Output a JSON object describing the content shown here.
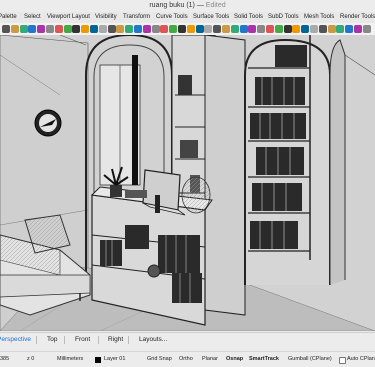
{
  "window": {
    "title": "ruang buku (1)",
    "separator": "—",
    "status": "Edited"
  },
  "menu_tabs": [
    "Palette",
    "Select",
    "Viewport Layout",
    "Visibility",
    "Transform",
    "Curve Tools",
    "Surface Tools",
    "Solid Tools",
    "SubD Tools",
    "Mesh Tools",
    "Render Tools"
  ],
  "toolbar_icons": [
    "pointer-icon",
    "undo-icon",
    "redo-icon",
    "copy-icon",
    "paste-icon",
    "pan-icon",
    "rotate-icon",
    "zoom-icon",
    "zoom-window-icon",
    "zoom-extents-icon",
    "perspective-icon",
    "top-view-icon",
    "front-view-icon",
    "right-view-icon",
    "layout-icon",
    "grid-icon",
    "ortho-icon",
    "planar-icon",
    "osnap-icon",
    "layer-icon",
    "properties-icon",
    "line-icon",
    "polyline-icon",
    "curve-icon",
    "circle-icon",
    "arc-icon",
    "rectangle-icon",
    "polygon-icon",
    "box-icon",
    "sphere-icon",
    "cylinder-icon",
    "extrude-icon",
    "loft-icon",
    "boolean-icon",
    "fillet-icon",
    "mirror-icon",
    "array-icon",
    "scale-icon",
    "material-icon",
    "render-icon",
    "sun-icon",
    "help-icon"
  ],
  "viewport_tabs": {
    "perspective": "Perspective",
    "top": "Top",
    "front": "Front",
    "right": "Right",
    "layouts": "Layouts..."
  },
  "status": {
    "x": "385",
    "z": "z 0",
    "units": "Millimeters",
    "layer": "Layer 01",
    "grid_snap": "Grid Snap",
    "ortho": "Ortho",
    "planar": "Planar",
    "osnap": "Osnap",
    "smarttrack": "SmartTrack",
    "gumball": "Gumball (CPlane)",
    "auto_cplane": "Auto CPlane"
  },
  "colors": {
    "accent": "#1a6fd8",
    "viewport_bg": "#c9c9c9"
  }
}
